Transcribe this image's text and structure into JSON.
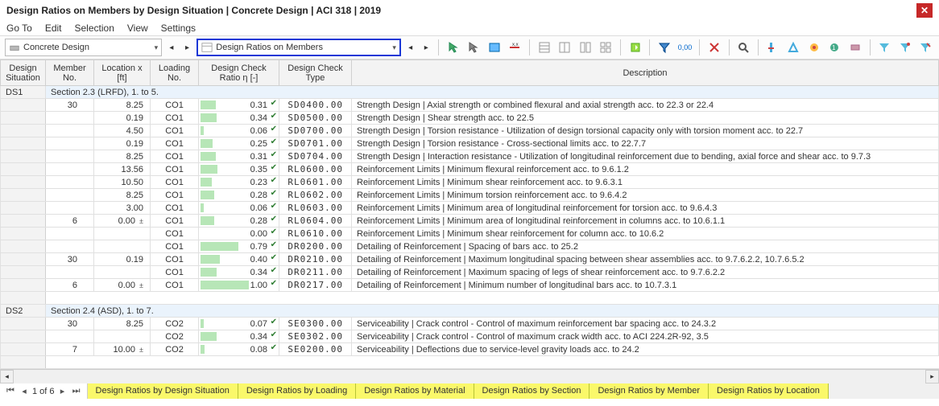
{
  "window_title": "Design Ratios on Members by Design Situation | Concrete Design | ACI 318 | 2019",
  "menubar": [
    "Go To",
    "Edit",
    "Selection",
    "View",
    "Settings"
  ],
  "combo_main": "Concrete Design",
  "combo_highlight": "Design Ratios on Members",
  "headers": {
    "situation": "Design Situation",
    "member": "Member No.",
    "location": "Location x [ft]",
    "loading": "Loading No.",
    "ratio": "Design Check Ratio η [-]",
    "type": "Design Check Type",
    "desc": "Description"
  },
  "groups": [
    {
      "ds": "DS1",
      "label": "Section 2.3 (LRFD), 1. to 5.",
      "rows": [
        {
          "member": "30",
          "loc": "8.25",
          "locsym": "",
          "load": "CO1",
          "ratio": 0.31,
          "type": "SD0400.00",
          "desc": "Strength Design | Axial strength or combined flexural and axial strength acc. to 22.3 or 22.4"
        },
        {
          "member": "",
          "loc": "0.19",
          "locsym": "",
          "load": "CO1",
          "ratio": 0.34,
          "type": "SD0500.00",
          "desc": "Strength Design | Shear strength acc. to 22.5"
        },
        {
          "member": "",
          "loc": "4.50",
          "locsym": "",
          "load": "CO1",
          "ratio": 0.06,
          "type": "SD0700.00",
          "desc": "Strength Design | Torsion resistance - Utilization of design torsional capacity only with torsion moment acc. to 22.7"
        },
        {
          "member": "",
          "loc": "0.19",
          "locsym": "",
          "load": "CO1",
          "ratio": 0.25,
          "type": "SD0701.00",
          "desc": "Strength Design | Torsion resistance - Cross-sectional limits acc. to 22.7.7"
        },
        {
          "member": "",
          "loc": "8.25",
          "locsym": "",
          "load": "CO1",
          "ratio": 0.31,
          "type": "SD0704.00",
          "desc": "Strength Design | Interaction resistance - Utilization of longitudinal reinforcement due to bending, axial force and shear acc. to 9.7.3"
        },
        {
          "member": "",
          "loc": "13.56",
          "locsym": "",
          "load": "CO1",
          "ratio": 0.35,
          "type": "RL0600.00",
          "desc": "Reinforcement Limits | Minimum flexural reinforcement acc. to 9.6.1.2"
        },
        {
          "member": "",
          "loc": "10.50",
          "locsym": "",
          "load": "CO1",
          "ratio": 0.23,
          "type": "RL0601.00",
          "desc": "Reinforcement Limits | Minimum shear reinforcement acc. to 9.6.3.1"
        },
        {
          "member": "",
          "loc": "8.25",
          "locsym": "",
          "load": "CO1",
          "ratio": 0.28,
          "type": "RL0602.00",
          "desc": "Reinforcement Limits | Minimum torsion reinforcement acc. to 9.6.4.2"
        },
        {
          "member": "",
          "loc": "3.00",
          "locsym": "",
          "load": "CO1",
          "ratio": 0.06,
          "type": "RL0603.00",
          "desc": "Reinforcement Limits | Minimum area of longitudinal reinforcement for torsion acc. to 9.6.4.3"
        },
        {
          "member": "6",
          "loc": "0.00",
          "locsym": "±",
          "load": "CO1",
          "ratio": 0.28,
          "type": "RL0604.00",
          "desc": "Reinforcement Limits | Minimum area of longitudinal reinforcement in columns acc. to 10.6.1.1"
        },
        {
          "member": "",
          "loc": "",
          "locsym": "",
          "load": "CO1",
          "ratio": 0.0,
          "type": "RL0610.00",
          "desc": "Reinforcement Limits | Minimum shear reinforcement for column acc. to 10.6.2"
        },
        {
          "member": "",
          "loc": "",
          "locsym": "",
          "load": "CO1",
          "ratio": 0.79,
          "type": "DR0200.00",
          "desc": "Detailing of Reinforcement | Spacing of bars acc. to 25.2"
        },
        {
          "member": "30",
          "loc": "0.19",
          "locsym": "",
          "load": "CO1",
          "ratio": 0.4,
          "type": "DR0210.00",
          "desc": "Detailing of Reinforcement | Maximum longitudinal spacing between shear assemblies acc. to 9.7.6.2.2, 10.7.6.5.2"
        },
        {
          "member": "",
          "loc": "",
          "locsym": "",
          "load": "CO1",
          "ratio": 0.34,
          "type": "DR0211.00",
          "desc": "Detailing of Reinforcement | Maximum spacing of legs of shear reinforcement acc. to 9.7.6.2.2"
        },
        {
          "member": "6",
          "loc": "0.00",
          "locsym": "±",
          "load": "CO1",
          "ratio": 1.0,
          "type": "DR0217.00",
          "desc": "Detailing of Reinforcement | Minimum number of longitudinal bars acc. to 10.7.3.1"
        }
      ]
    },
    {
      "ds": "DS2",
      "label": "Section 2.4 (ASD), 1. to 7.",
      "rows": [
        {
          "member": "30",
          "loc": "8.25",
          "locsym": "",
          "load": "CO2",
          "ratio": 0.07,
          "type": "SE0300.00",
          "desc": "Serviceability | Crack control - Control of maximum reinforcement bar spacing acc. to 24.3.2"
        },
        {
          "member": "",
          "loc": "",
          "locsym": "",
          "load": "CO2",
          "ratio": 0.34,
          "type": "SE0302.00",
          "desc": "Serviceability | Crack control - Control of maximum crack width acc. to ACI 224.2R-92, 3.5"
        },
        {
          "member": "7",
          "loc": "10.00",
          "locsym": "±",
          "load": "CO2",
          "ratio": 0.08,
          "type": "SE0200.00",
          "desc": "Serviceability | Deflections due to service-level gravity loads acc. to 24.2"
        }
      ]
    }
  ],
  "pager": "1 of 6",
  "tabs": [
    "Design Ratios by Design Situation",
    "Design Ratios by Loading",
    "Design Ratios by Material",
    "Design Ratios by Section",
    "Design Ratios by Member",
    "Design Ratios by Location"
  ]
}
